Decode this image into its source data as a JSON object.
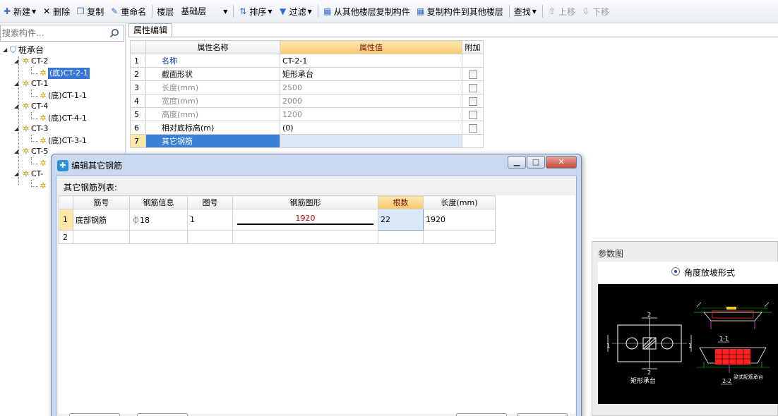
{
  "toolbar": {
    "new": "新建",
    "delete": "删除",
    "copy": "复制",
    "rename": "重命名",
    "floor_label": "楼层",
    "floor_value": "基础层",
    "sort": "排序",
    "filter": "过滤",
    "copy_from_other_floor": "从其他楼层复制构件",
    "copy_to_other_floor": "复制构件到其他楼层",
    "find": "查找",
    "move_up": "上移",
    "move_down": "下移"
  },
  "search": {
    "placeholder": "搜索构件..."
  },
  "tree": {
    "root": "桩承台",
    "items": [
      {
        "label": "CT-2",
        "child": "(底)CT-2-1"
      },
      {
        "label": "CT-1",
        "child": "(底)CT-1-1"
      },
      {
        "label": "CT-4",
        "child": "(底)CT-4-1"
      },
      {
        "label": "CT-3",
        "child": "(底)CT-3-1"
      },
      {
        "label": "CT-5"
      },
      {
        "label": "CT-"
      }
    ]
  },
  "property": {
    "tab": "属性编辑",
    "headers": {
      "name": "属性名称",
      "value": "属性值",
      "extra": "附加"
    },
    "rows": [
      {
        "no": "1",
        "name": "名称",
        "value": "CT-2-1"
      },
      {
        "no": "2",
        "name": "截面形状",
        "value": "矩形承台"
      },
      {
        "no": "3",
        "name": "长度(mm)",
        "value": "2500"
      },
      {
        "no": "4",
        "name": "宽度(mm)",
        "value": "2000"
      },
      {
        "no": "5",
        "name": "高度(mm)",
        "value": "1200"
      },
      {
        "no": "6",
        "name": "相对底标高(m)",
        "value": "(0)"
      },
      {
        "no": "7",
        "name": "其它钢筋",
        "value": ""
      }
    ]
  },
  "dialog": {
    "title": "编辑其它钢筋",
    "list_label": "其它钢筋列表:",
    "headers": {
      "bar_no": "筋号",
      "bar_info": "钢筋信息",
      "fig_no": "图号",
      "bar_shape": "钢筋图形",
      "count": "根数",
      "length": "长度(mm)"
    },
    "rows": [
      {
        "no": "1",
        "bar_no": "底部钢筋",
        "bar_info": "⏀18",
        "fig_no": "1",
        "shape_length": "1920",
        "count": "22",
        "length": "1920"
      },
      {
        "no": "2",
        "bar_no": "",
        "bar_info": "",
        "fig_no": "",
        "shape_length": "",
        "count": "",
        "length": ""
      }
    ]
  },
  "param": {
    "title": "参数图",
    "option": "角度放坡形式",
    "drawing": {
      "dim_top": "2",
      "dim_left": "1",
      "dim_right": "1",
      "dim_bottom": "2",
      "label_rect": "矩形承台",
      "label_1_1": "1-1",
      "label_2_2": "2-2",
      "label_rebar": "梁式配筋承台"
    }
  }
}
